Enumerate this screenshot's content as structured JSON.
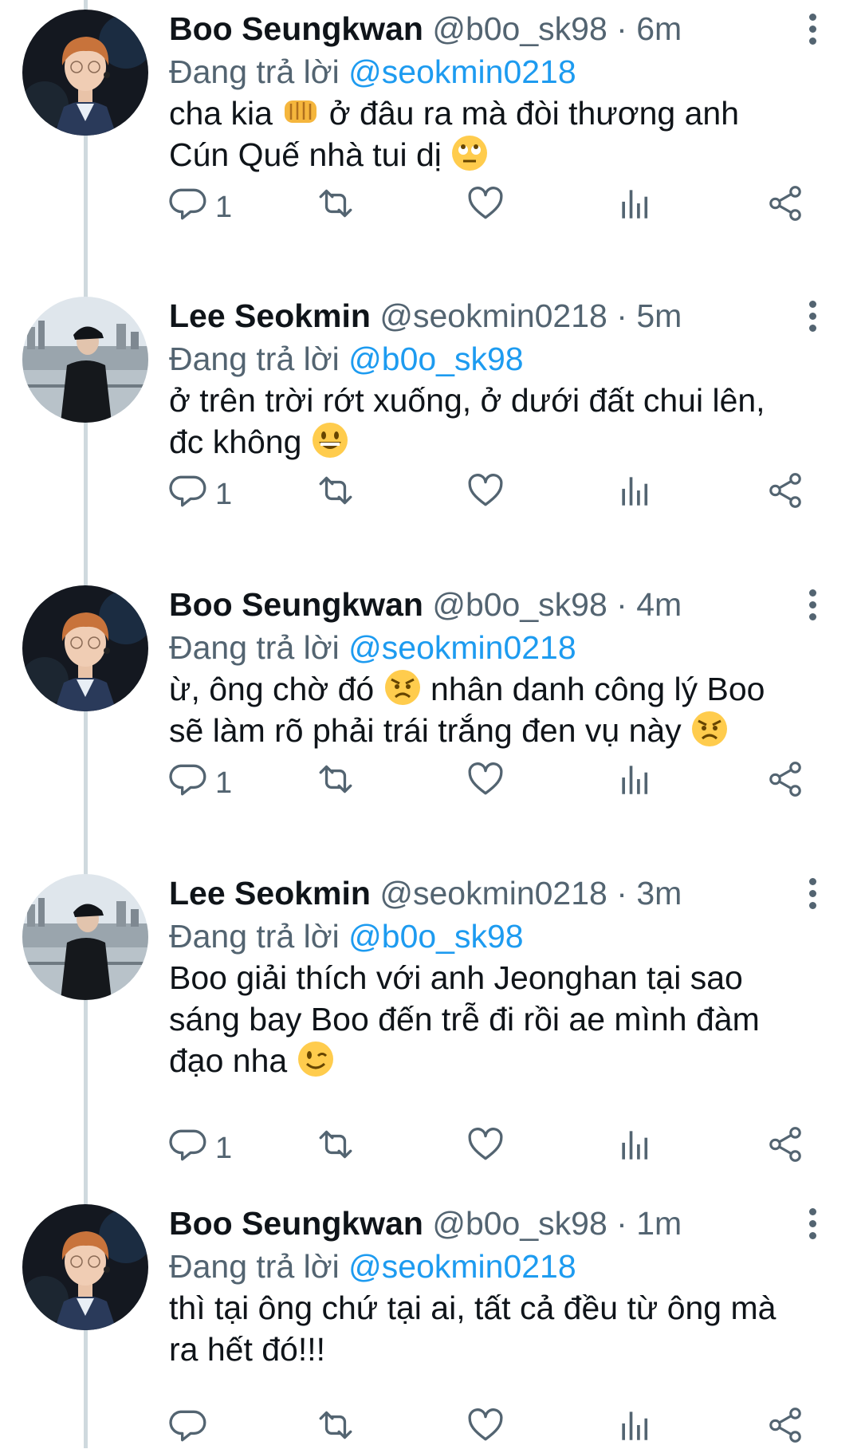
{
  "reply_prefix": "Đang trả lời",
  "separator": "·",
  "tweets": [
    {
      "name": "Boo Seungkwan",
      "handle": "@b0o_sk98",
      "time": "6m",
      "reply_to": "@seokmin0218",
      "line1": "cha kia",
      "line1b": "ở đâu ra mà đòi thương anh",
      "line2": "Cún Quế nhà tui dị",
      "reply_count": "1"
    },
    {
      "name": "Lee Seokmin",
      "handle": "@seokmin0218",
      "time": "5m",
      "reply_to": "@b0o_sk98",
      "line1": "ở trên trời rớt xuống, ở dưới đất chui lên,",
      "line2": "đc không",
      "reply_count": "1"
    },
    {
      "name": "Boo Seungkwan",
      "handle": "@b0o_sk98",
      "time": "4m",
      "reply_to": "@seokmin0218",
      "line1": "ừ, ông chờ đó",
      "line1b": "nhân danh công lý Boo",
      "line2": "sẽ làm rõ phải trái trắng đen vụ này",
      "reply_count": "1"
    },
    {
      "name": "Lee Seokmin",
      "handle": "@seokmin0218",
      "time": "3m",
      "reply_to": "@b0o_sk98",
      "line1": "Boo giải thích với anh Jeonghan tại sao",
      "line2": "sáng bay Boo đến trễ đi rồi ae mình đàm",
      "line3": "đạo nha",
      "reply_count": "1"
    },
    {
      "name": "Boo Seungkwan",
      "handle": "@b0o_sk98",
      "time": "1m",
      "reply_to": "@seokmin0218",
      "line1": "thì tại ông chứ tại ai, tất cả đều từ ông mà",
      "line2": "ra hết đó!!!",
      "reply_count": ""
    }
  ],
  "icons": {
    "reply": "reply-icon",
    "retweet": "retweet-icon",
    "like": "heart-icon",
    "stats": "analytics-icon",
    "share": "share-icon",
    "more": "more-vertical-icon"
  },
  "colors": {
    "link": "#1d9bf0",
    "secondary": "#536471",
    "text": "#0f1419",
    "thread_line": "#cfd9de"
  }
}
